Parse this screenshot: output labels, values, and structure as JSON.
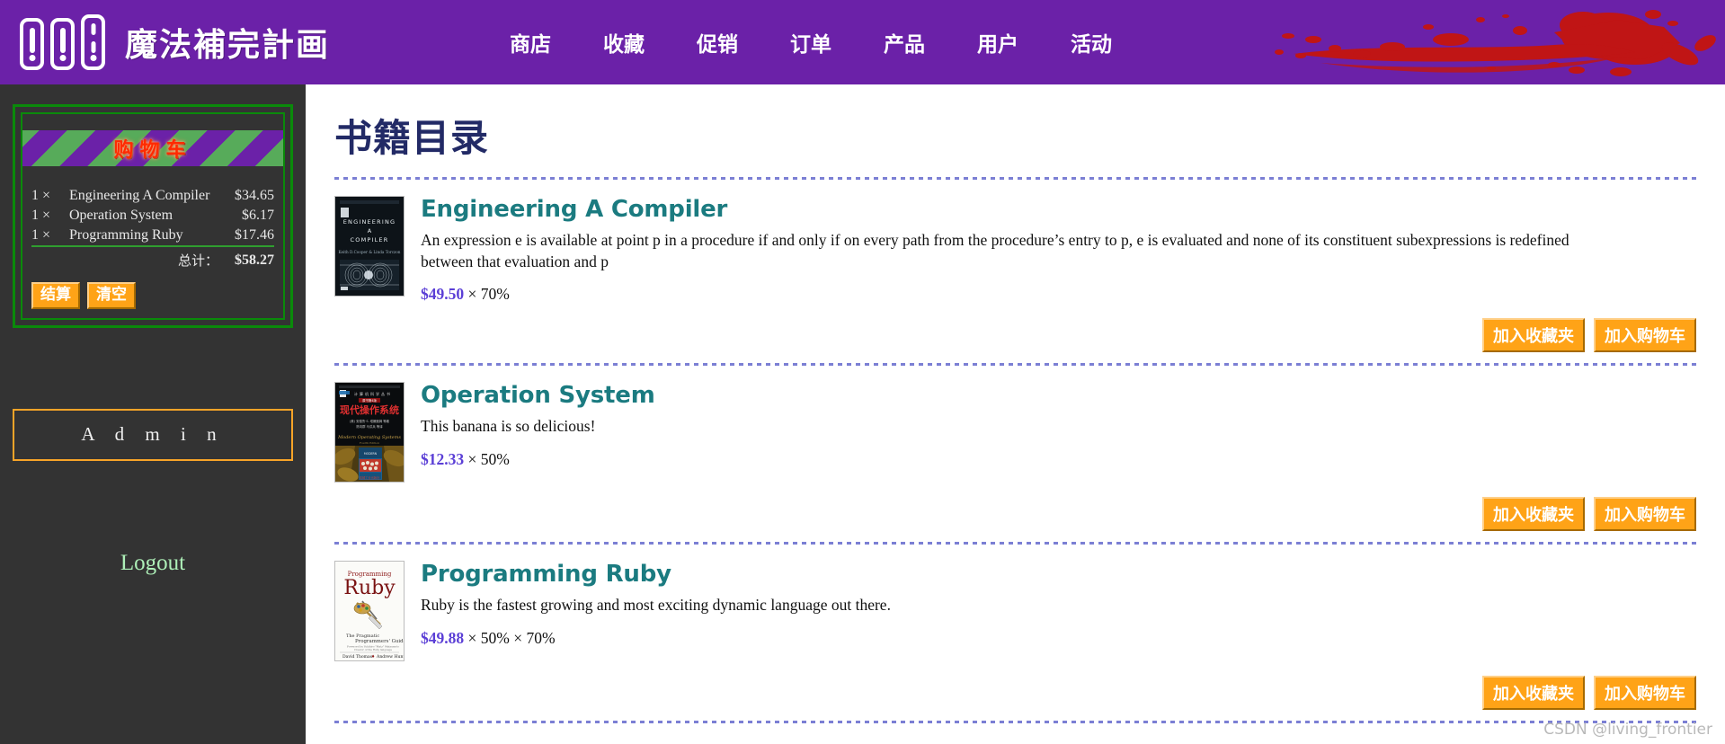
{
  "header": {
    "brand": "魔法補完計画",
    "logo_icon": "three-books-icon",
    "splatter_icon": "red-paint-splatter-icon",
    "splatter_color": "#C01515",
    "background_color": "#6B21A8",
    "nav": [
      {
        "label": "商店"
      },
      {
        "label": "收藏"
      },
      {
        "label": "促销"
      },
      {
        "label": "订单"
      },
      {
        "label": "产品"
      },
      {
        "label": "用户"
      },
      {
        "label": "活动"
      }
    ]
  },
  "sidebar": {
    "background_color": "#333333",
    "cart": {
      "title": "购物车",
      "title_color": "#FF2A00",
      "border_color": "#0A8A0A",
      "stripe_colors": [
        "#57AB5A",
        "#6B21A8"
      ],
      "items": [
        {
          "qty": "1 ×",
          "name": "Engineering A Compiler",
          "price": "$34.65"
        },
        {
          "qty": "1 ×",
          "name": "Operation System",
          "price": "$6.17"
        },
        {
          "qty": "1 ×",
          "name": "Programming Ruby",
          "price": "$17.46"
        }
      ],
      "total_label": "总计：",
      "total_value": "$58.27",
      "checkout_label": "结算",
      "clear_label": "清空",
      "button_color": "#FFA317"
    },
    "admin_label": "A d m i n",
    "admin_border_color": "#F7A428",
    "logout_label": "Logout",
    "logout_color": "#AEF0B8"
  },
  "main": {
    "page_title": "书籍目录",
    "page_title_color": "#222A66",
    "divider_color": "#7B7FD4",
    "favorite_button_label": "加入收藏夹",
    "cart_button_label": "加入购物车",
    "books": [
      {
        "cover_icon": "engineering-a-compiler-cover",
        "title": "Engineering A Compiler",
        "description": "An expression e is available at point p in a procedure if and only if on every path from the procedure’s entry to p, e is evaluated and none of its constituent subexpressions is redefined between that evaluation and p",
        "price": "$49.50",
        "discount": " × 70%"
      },
      {
        "cover_icon": "operation-system-cover",
        "title": "Operation System",
        "description": "This banana is so delicious!",
        "price": "$12.33",
        "discount": " × 50%"
      },
      {
        "cover_icon": "programming-ruby-cover",
        "title": "Programming Ruby",
        "description": "Ruby is the fastest growing and most exciting dynamic language out there.",
        "price": "$49.88",
        "discount": " × 50% × 70%"
      }
    ],
    "title_color": "#1B7B80",
    "price_color": "#5B3FD6"
  },
  "watermark": "CSDN @living_frontier"
}
